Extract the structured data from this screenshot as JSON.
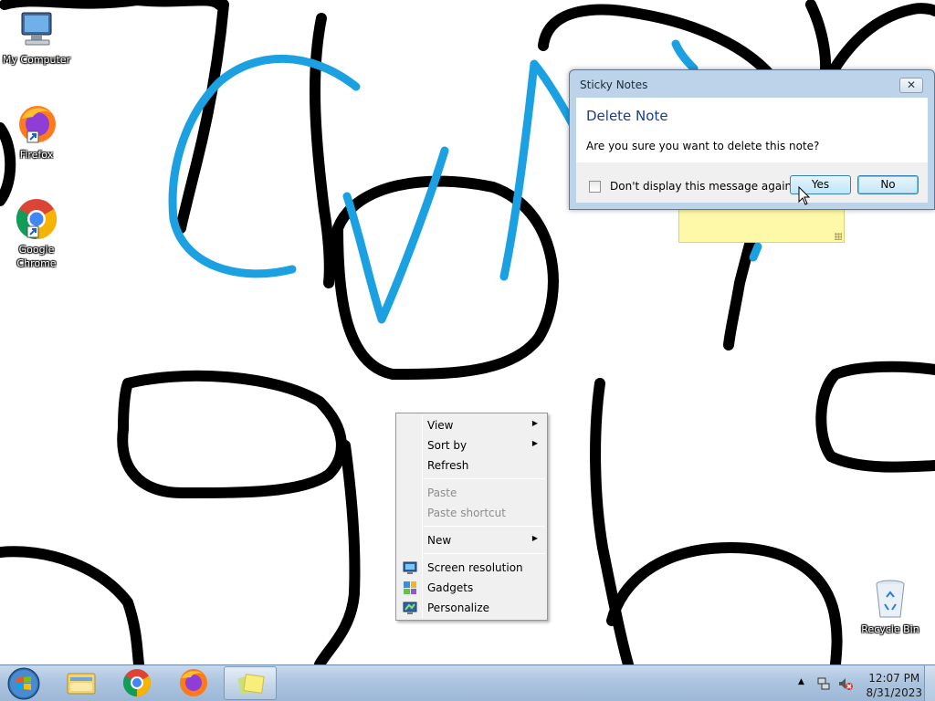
{
  "desktop_icons": [
    {
      "label": "My Computer",
      "icon": "computer-icon"
    },
    {
      "label": "Firefox",
      "icon": "firefox-icon"
    },
    {
      "label": "Google Chrome",
      "icon": "chrome-icon"
    },
    {
      "label": "Recycle Bin",
      "icon": "recycle-bin-icon"
    }
  ],
  "dialog": {
    "title": "Sticky Notes",
    "close_label": "✕",
    "heading": "Delete Note",
    "message": "Are you sure you want to delete this note?",
    "checkbox_label": "Don't display this message again",
    "checkbox_checked": false,
    "yes_label": "Yes",
    "no_label": "No"
  },
  "context_menu": {
    "items": [
      {
        "label": "View",
        "submenu": true,
        "enabled": true
      },
      {
        "label": "Sort by",
        "submenu": true,
        "enabled": true
      },
      {
        "label": "Refresh",
        "submenu": false,
        "enabled": true
      },
      {
        "label": "Paste",
        "submenu": false,
        "enabled": false
      },
      {
        "label": "Paste shortcut",
        "submenu": false,
        "enabled": false
      },
      {
        "label": "New",
        "submenu": true,
        "enabled": true
      },
      {
        "label": "Screen resolution",
        "submenu": false,
        "enabled": true,
        "icon": "screen-resolution-icon"
      },
      {
        "label": "Gadgets",
        "submenu": false,
        "enabled": true,
        "icon": "gadgets-icon"
      },
      {
        "label": "Personalize",
        "submenu": false,
        "enabled": true,
        "icon": "personalize-icon"
      }
    ]
  },
  "taskbar": {
    "pinned": [
      "windows-explorer-icon",
      "chrome-icon",
      "firefox-icon",
      "sticky-notes-icon"
    ],
    "active": "sticky-notes-icon",
    "clock_time": "12:07 PM",
    "clock_date": "8/31/2023"
  },
  "colors": {
    "stroke_black": "#000000",
    "stroke_blue": "#1ba1e2",
    "sticky_yellow": "#fdf9a8",
    "dialog_frame": "#bcd3ea",
    "taskbar": "#aac3df"
  }
}
